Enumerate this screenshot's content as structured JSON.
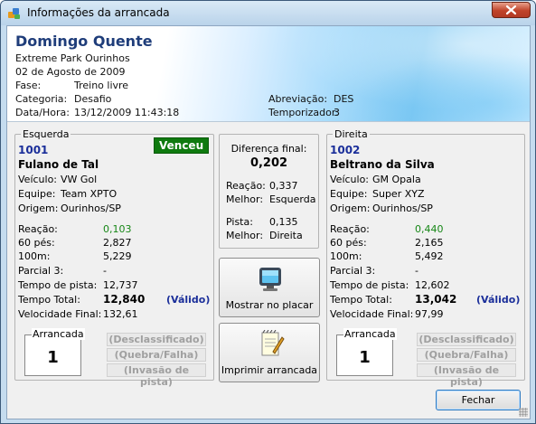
{
  "window": {
    "title": "Informações da arrancada"
  },
  "event": {
    "name": "Domingo Quente",
    "venue": "Extreme Park Ourinhos",
    "date": "02 de Agosto de 2009",
    "fase_label": "Fase:",
    "fase_value": "Treino livre",
    "categoria_label": "Categoria:",
    "categoria_value": "Desafio",
    "datahora_label": "Data/Hora:",
    "datahora_value": "13/12/2009 11:43:18",
    "abreviacao_label": "Abreviação:",
    "abreviacao_value": "DES",
    "temporizador_label": "Temporizador:",
    "temporizador_value": "3"
  },
  "labels": {
    "veiculo": "Veículo:",
    "equipe": "Equipe:",
    "origem": "Origem:",
    "reacao": "Reação:",
    "sessenta": "60 pés:",
    "cem": "100m:",
    "parcial": "Parcial 3:",
    "tempo_pista": "Tempo de pista:",
    "tempo_total": "Tempo Total:",
    "velocidade": "Velocidade Final:",
    "arrancada": "Arrancada",
    "desclassificado": "(Desclassificado)",
    "quebra": "(Quebra/Falha)",
    "invasao": "(Invasão de pista)"
  },
  "left": {
    "group_label": "Esquerda",
    "number": "1001",
    "driver": "Fulano de Tal",
    "badge": "Venceu",
    "veiculo": "VW Gol",
    "equipe": "Team XPTO",
    "origem": "Ourinhos/SP",
    "reacao": "0,103",
    "sessenta": "2,827",
    "cem": "5,229",
    "parcial": "-",
    "tempo_pista": "12,737",
    "tempo_total": "12,840",
    "validity": "(Válido)",
    "velocidade": "132,61",
    "arrancada_num": "1"
  },
  "right": {
    "group_label": "Direita",
    "number": "1002",
    "driver": "Beltrano da Silva",
    "veiculo": "GM Opala",
    "equipe": "Super XYZ",
    "origem": "Ourinhos/SP",
    "reacao": "0,440",
    "sessenta": "2,165",
    "cem": "5,492",
    "parcial": "-",
    "tempo_pista": "12,602",
    "tempo_total": "13,042",
    "validity": "(Válido)",
    "velocidade": "97,99",
    "arrancada_num": "1"
  },
  "center": {
    "diff_label": "Diferença final:",
    "diff_value": "0,202",
    "reacao_label": "Reação:",
    "reacao_value": "0,337",
    "melhor_label": "Melhor:",
    "melhor_reacao": "Esquerda",
    "pista_label": "Pista:",
    "pista_value": "0,135",
    "melhor_pista": "Direita"
  },
  "buttons": {
    "mostrar_placar": "Mostrar no placar",
    "imprimir": "Imprimir arrancada",
    "fechar": "Fechar"
  },
  "colors": {
    "accent_blue": "#1b2f9a",
    "win_green": "#0f7a0f",
    "reaction_green": "#168716"
  },
  "icons": {
    "title": "app-icon",
    "placar": "monitor-icon",
    "imprimir": "printer-note-icon",
    "close": "close-icon"
  }
}
